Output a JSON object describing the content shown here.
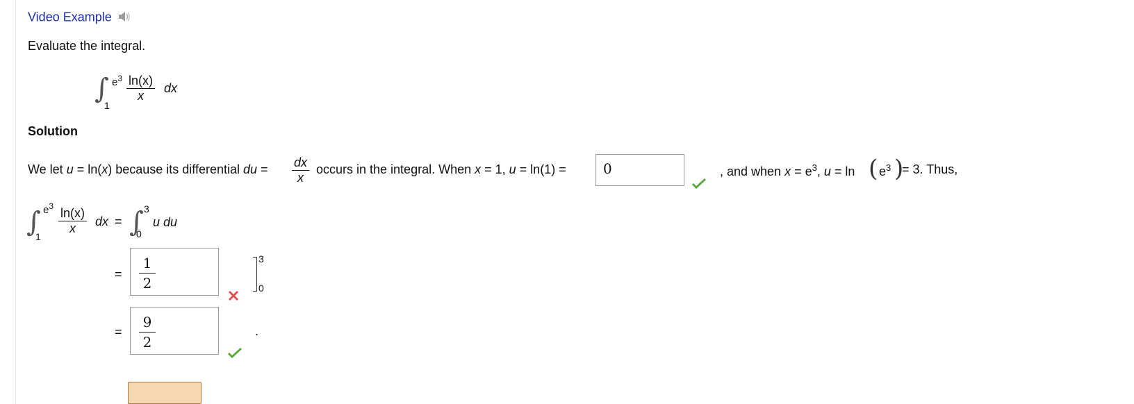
{
  "header": {
    "video_link": "Video Example"
  },
  "problem": {
    "prompt": "Evaluate the integral.",
    "integrand_num": "ln(x)",
    "integrand_den": "x",
    "upper": "e",
    "upper_exp": "3",
    "lower": "1",
    "dx": "dx"
  },
  "solution": {
    "heading": "Solution",
    "sentence_part1": "We let ",
    "u": "u",
    "eq_lnx": " = ln(",
    "x": "x",
    "close_because": ") because its differential ",
    "du": "du",
    "eq": " = ",
    "dx": "dx",
    "occurs": " occurs in the integral. When ",
    "when_x_eq1": " = 1, ",
    "u_eq_ln1": " = ln(1) = ",
    "answer1": "0",
    "and_when": ", and when ",
    "x_eq_e": " = e",
    "exp3": "3",
    "comma_u": ", ",
    "u_eq_ln": " = ln",
    "e": "e",
    "eq3_thus": " = 3. Thus,",
    "rhs_upper": "3",
    "rhs_lower": "0",
    "u_du": "u du",
    "equals": "=",
    "answer2_num": "1",
    "answer2_den": "2",
    "eval_upper": "3",
    "eval_lower": "0",
    "answer3_num": "9",
    "answer3_den": "2",
    "period": "."
  },
  "colors": {
    "link": "#1a2fa8",
    "correct": "#5aa83c",
    "incorrect": "#e24b4b"
  }
}
